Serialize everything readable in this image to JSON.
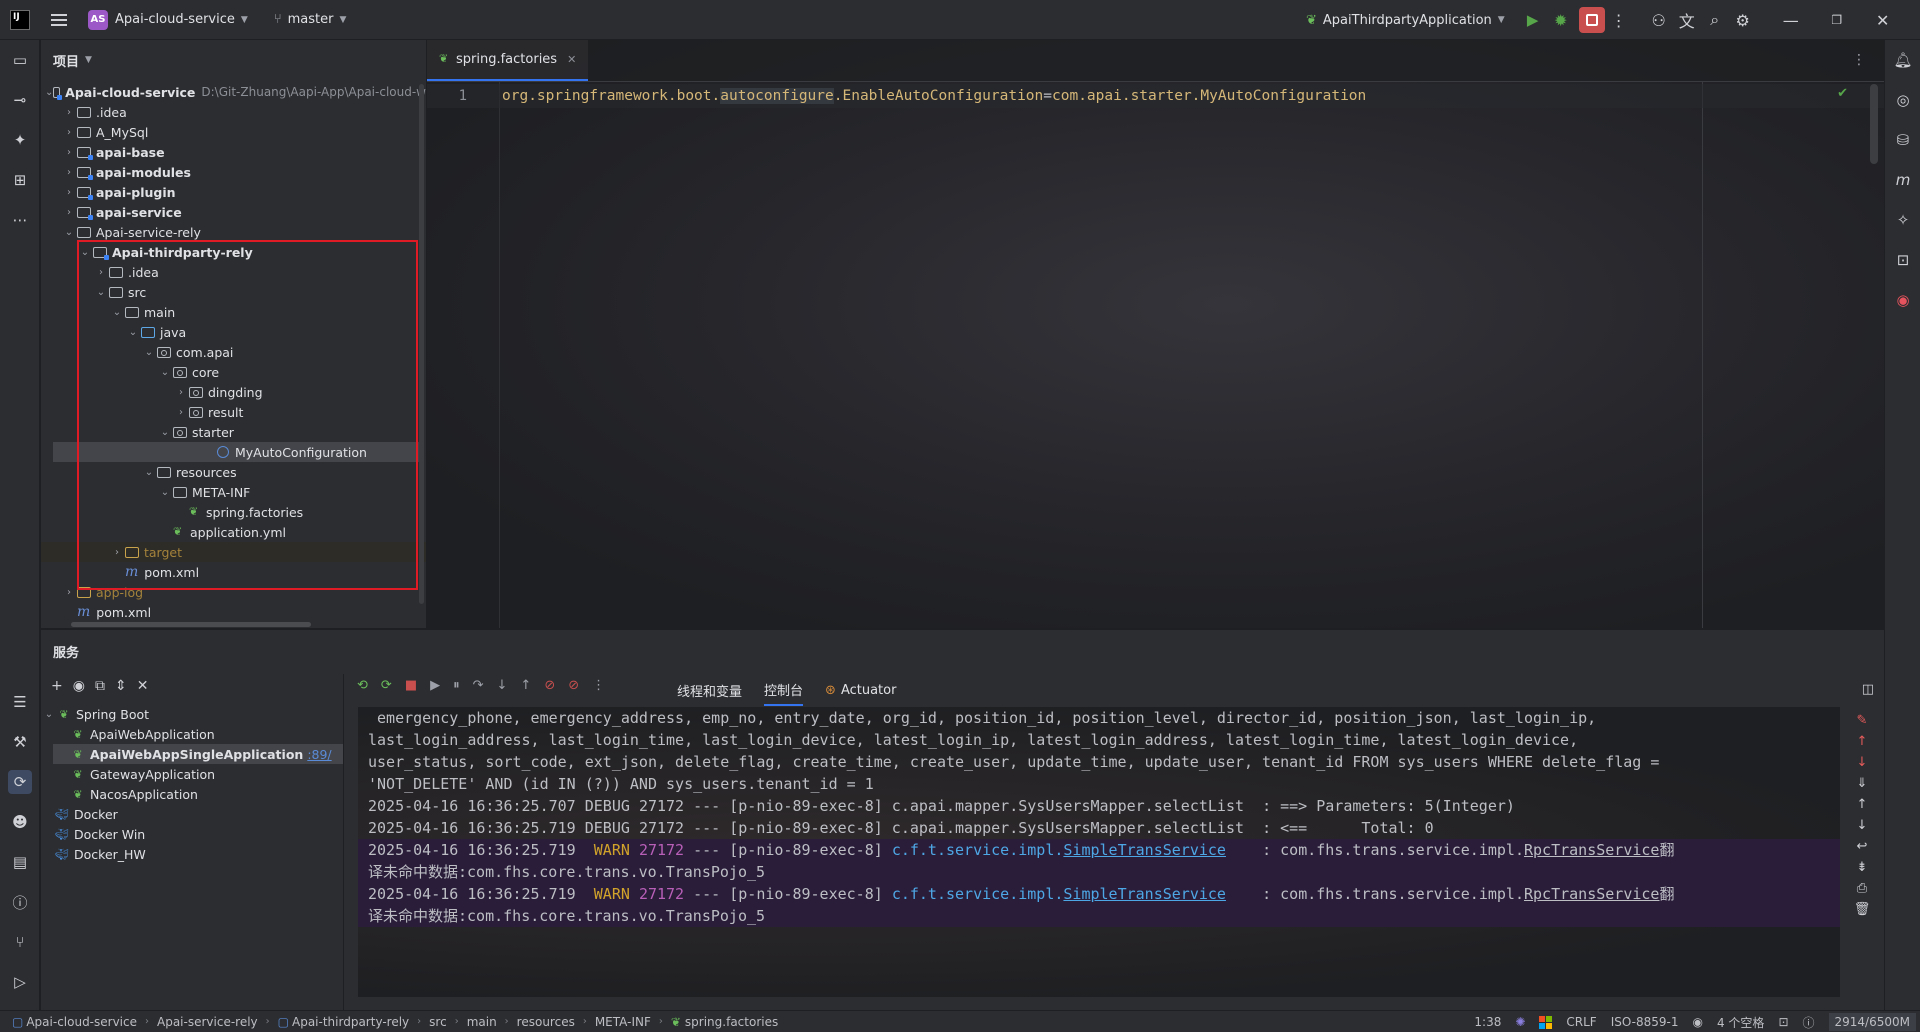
{
  "titlebar": {
    "project_badge": "AS",
    "project_name": "Apai-cloud-service",
    "branch": "master",
    "run_config": "ApaiThirdpartyApplication"
  },
  "project_panel": {
    "title": "项目",
    "root": {
      "label": "Apai-cloud-service",
      "path": "D:\\Git-Zhuang\\Aapi-App\\Apai-cloud-w"
    },
    "items": [
      {
        "label": ".idea"
      },
      {
        "label": "A_MySql"
      },
      {
        "label": "apai-base"
      },
      {
        "label": "apai-modules"
      },
      {
        "label": "apai-plugin"
      },
      {
        "label": "apai-service"
      },
      {
        "label": "Apai-service-rely"
      },
      {
        "label": "Apai-thirdparty-rely"
      },
      {
        "label": ".idea"
      },
      {
        "label": "src"
      },
      {
        "label": "main"
      },
      {
        "label": "java"
      },
      {
        "label": "com.apai"
      },
      {
        "label": "core"
      },
      {
        "label": "dingding"
      },
      {
        "label": "result"
      },
      {
        "label": "starter"
      },
      {
        "label": "MyAutoConfiguration"
      },
      {
        "label": "resources"
      },
      {
        "label": "META-INF"
      },
      {
        "label": "spring.factories"
      },
      {
        "label": "application.yml"
      },
      {
        "label": "target"
      },
      {
        "label": "pom.xml"
      },
      {
        "label": "app-log"
      },
      {
        "label": "pom.xml"
      }
    ]
  },
  "editor": {
    "tab": "spring.factories",
    "line_number": "1",
    "code": {
      "part1": "org.springframework.boot.",
      "part2": "autoconfigure",
      "part3": ".EnableAutoConfiguration",
      "part4": "=",
      "part5": "com.apai.starter.MyAutoConfiguration"
    }
  },
  "services": {
    "title": "服务",
    "tree": [
      {
        "label": "Spring Boot"
      },
      {
        "label": "ApaiWebApplication"
      },
      {
        "label": "ApaiWebAppSingleApplication",
        "port": ":89/"
      },
      {
        "label": "GatewayApplication"
      },
      {
        "label": "NacosApplication"
      },
      {
        "label": "Docker"
      },
      {
        "label": "Docker Win"
      },
      {
        "label": "Docker_HW"
      }
    ],
    "tabs": {
      "threads": "线程和变量",
      "console": "控制台",
      "actuator": "Actuator"
    },
    "console": {
      "l1": " emergency_phone, emergency_address, emp_no, entry_date, org_id, position_id, position_level, director_id, position_json, last_login_ip,",
      "l2": "last_login_address, last_login_time, last_login_device, latest_login_ip, latest_login_address, latest_login_time, latest_login_device,",
      "l3": "user_status, sort_code, ext_json, delete_flag, create_time, create_user, update_time, update_user, tenant_id FROM sys_users WHERE delete_flag =",
      "l4": "'NOT_DELETE' AND (id IN (?)) AND sys_users.tenant_id = 1",
      "l5_ts": "2025-04-16 16:36:25.707",
      "l5_level": "DEBUG",
      "l5_pid": "27172",
      "l5_rest": "--- [p-nio-89-exec-8] c.apai.mapper.SysUsersMapper.selectList  : ==> Parameters: 5(Integer)",
      "l6_ts": "2025-04-16 16:36:25.719",
      "l6_level": "DEBUG",
      "l6_pid": "27172",
      "l6_rest": "--- [p-nio-89-exec-8] c.apai.mapper.SysUsersMapper.selectList  : <==      Total: 0",
      "w_ts": "2025-04-16 16:36:25.719",
      "w_level": "WARN",
      "w_pid": "27172",
      "w_thread": "--- [p-nio-89-exec-8]",
      "w_cls_prefix": "c.f.t.service.impl.",
      "w_cls_link": "SimpleTransService",
      "w_msg_prefix": ": com.fhs.trans.service.impl.",
      "w_msg_link": "RpcTransService",
      "w_msg_tail": "翻",
      "w_cont": "译未命中数据:com.fhs.core.trans.vo.TransPojo_5"
    }
  },
  "statusbar": {
    "crumbs": [
      "Apai-cloud-service",
      "Apai-service-rely",
      "Apai-thirdparty-rely",
      "src",
      "main",
      "resources",
      "META-INF",
      "spring.factories"
    ],
    "position": "1:38",
    "line_sep": "CRLF",
    "encoding": "ISO-8859-1",
    "indent": "4 个空格",
    "memory": "2914/6500M"
  },
  "colors": {
    "accent": "#3574f0",
    "highlight_box": "#e11b25",
    "run": "#57a64a",
    "stop": "#c94f4f"
  }
}
